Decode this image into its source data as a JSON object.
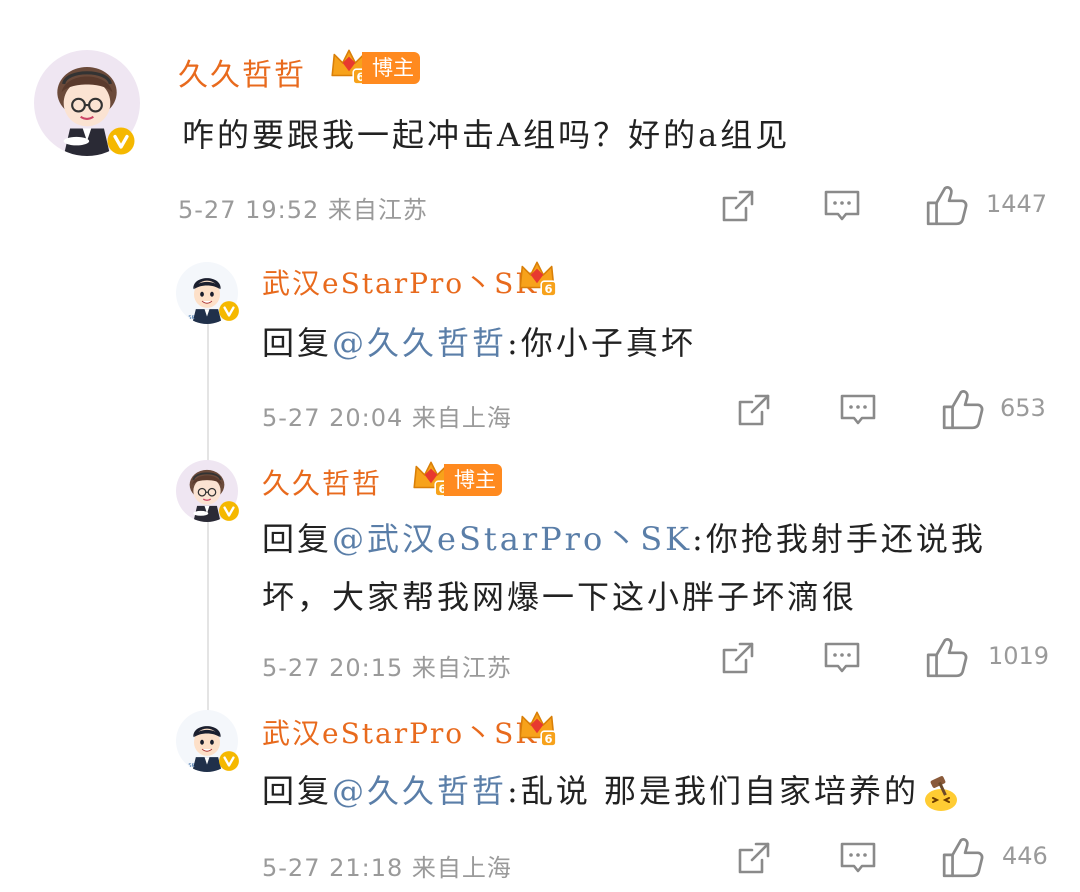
{
  "comments": [
    {
      "username": "久久哲哲",
      "tag": "博主",
      "level": "6",
      "text": "咋的要跟我一起冲击A组吗？好的a组见",
      "meta": "5-27 19:52  来自江苏",
      "likes": "1447"
    },
    {
      "username": "武汉eStarPro丶SK",
      "level": "6",
      "reply_prefix": "回复",
      "mention": "@久久哲哲",
      "text": ":你小子真坏",
      "meta": "5-27 20:04  来自上海",
      "likes": "653"
    },
    {
      "username": "久久哲哲",
      "tag": "博主",
      "level": "6",
      "reply_prefix": "回复",
      "mention": "@武汉eStarPro丶SK",
      "text_line1": ":你抢我射手还说我",
      "text_line2": "坏，大家帮我网爆一下这小胖子坏滴很",
      "meta": "5-27 20:15  来自江苏",
      "likes": "1019"
    },
    {
      "username": "武汉eStarPro丶SK",
      "level": "6",
      "reply_prefix": "回复",
      "mention": "@久久哲哲",
      "text": ":乱说 那是我们自家培养的",
      "meta": "5-27 21:18  来自上海",
      "likes": "446"
    }
  ],
  "colors": {
    "username": "#e86a1d",
    "mention": "#5a7ea8",
    "meta": "#9a9a9a",
    "tag_bg": "#ff8a1f",
    "verified": "#f5b800"
  },
  "icons": [
    "share-icon",
    "comment-icon",
    "like-icon",
    "crown-icon",
    "verified-icon",
    "judge-emoji-icon"
  ]
}
